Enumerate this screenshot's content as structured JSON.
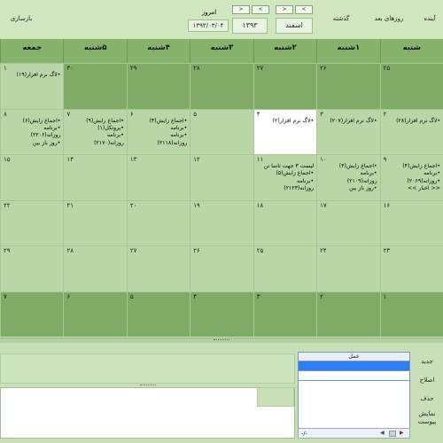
{
  "toolbar": {
    "future": "آینده",
    "next_days": "روزهای بعد",
    "past": "گذشته",
    "refresh": "بازسازی",
    "month": "اسفند",
    "year": "۱۳۹۳",
    "today_label": "امروز",
    "today_date": "۱۳۹۳/۰۳/۰۴",
    "nav_prev": "<",
    "nav_next": ">"
  },
  "weekdays": [
    "شنبه",
    "۱شنبه",
    "۲شنبه",
    "۳شنبه",
    "۴شنبه",
    "۵شنبه",
    "جمعه"
  ],
  "rows": [
    [
      {
        "n": "۲۵",
        "shade": "dark",
        "events": []
      },
      {
        "n": "۲۶",
        "shade": "dark",
        "events": []
      },
      {
        "n": "۲۷",
        "shade": "dark",
        "events": []
      },
      {
        "n": "۲۸",
        "shade": "dark",
        "events": []
      },
      {
        "n": "۲۹",
        "shade": "dark",
        "events": []
      },
      {
        "n": "۳۰",
        "shade": "dark",
        "events": []
      },
      {
        "n": "۱",
        "shade": "light",
        "events": [
          "•لاگ نرم افزار(۱۹)"
        ]
      }
    ],
    [
      {
        "n": "۲",
        "shade": "light",
        "events": [
          "•لاگ نرم افزار(۲۸)"
        ]
      },
      {
        "n": "۳",
        "shade": "light",
        "events": [
          "•لاگ نرم افزار(۲۰۷)"
        ]
      },
      {
        "n": "۴",
        "shade": "sel",
        "events": [
          "•لاگ نرم افزار(۲)"
        ]
      },
      {
        "n": "۵",
        "shade": "light",
        "events": []
      },
      {
        "n": "۶",
        "shade": "light",
        "events": [
          "•اجماع زایش(۳)",
          "•برنامه",
          "•برنامه",
          "روزانه(۲۱۱۸)"
        ]
      },
      {
        "n": "۷",
        "shade": "light",
        "events": [
          "•اجماع زایش(۹)",
          "•پروتکل(۱)",
          "•برنامه",
          "روزانه(۲۱۷۰)"
        ]
      },
      {
        "n": "۸",
        "shade": "light",
        "events": [
          "•اجماع زایش(۶)",
          "•برنامه",
          "روزانه(۲۲۰۶)",
          "•روز باز بین"
        ]
      }
    ],
    [
      {
        "n": "۹",
        "shade": "light",
        "events": [
          "•اجماع زایش(۴)",
          "•برنامه",
          "•روزانه(۲۰۶۹)",
          "<< اخبار >>"
        ]
      },
      {
        "n": "۱۰",
        "shade": "light",
        "events": [
          "•اجماع زایش(۴)",
          "•برنامه",
          "روزانه(۲۱۰۹)",
          "•روز باز بین"
        ]
      },
      {
        "n": "۱۱",
        "shade": "light",
        "events": [
          "لیست ۳ جهت تاسا تن",
          "•اجماع زایش(۵)",
          "•برنامه",
          "روزانه(۲۱۲۳)"
        ]
      },
      {
        "n": "۱۲",
        "shade": "light",
        "events": []
      },
      {
        "n": "۱۳",
        "shade": "light",
        "events": []
      },
      {
        "n": "۱۴",
        "shade": "light",
        "events": []
      },
      {
        "n": "۱۵",
        "shade": "light",
        "events": []
      }
    ],
    [
      {
        "n": "۱۶",
        "shade": "light",
        "events": []
      },
      {
        "n": "۱۷",
        "shade": "light",
        "events": []
      },
      {
        "n": "۱۸",
        "shade": "light",
        "events": []
      },
      {
        "n": "۱۹",
        "shade": "light",
        "events": []
      },
      {
        "n": "۲۰",
        "shade": "light",
        "events": []
      },
      {
        "n": "۲۱",
        "shade": "light",
        "events": []
      },
      {
        "n": "۲۲",
        "shade": "light",
        "events": []
      }
    ],
    [
      {
        "n": "۲۳",
        "shade": "light",
        "events": []
      },
      {
        "n": "۲۴",
        "shade": "light",
        "events": []
      },
      {
        "n": "۲۵",
        "shade": "light",
        "events": []
      },
      {
        "n": "۲۶",
        "shade": "light",
        "events": []
      },
      {
        "n": "۲۷",
        "shade": "light",
        "events": []
      },
      {
        "n": "۲۸",
        "shade": "light",
        "events": []
      },
      {
        "n": "۲۹",
        "shade": "light",
        "events": []
      }
    ],
    [
      {
        "n": "۱",
        "shade": "dark",
        "events": []
      },
      {
        "n": "۲",
        "shade": "dark",
        "events": []
      },
      {
        "n": "۳",
        "shade": "dark",
        "events": []
      },
      {
        "n": "۴",
        "shade": "dark",
        "events": []
      },
      {
        "n": "۵",
        "shade": "dark",
        "events": []
      },
      {
        "n": "۶",
        "shade": "dark",
        "events": []
      },
      {
        "n": "۷",
        "shade": "dark",
        "events": []
      }
    ]
  ],
  "panel": {
    "new": "جدید",
    "edit": "اصلاح",
    "delete": "حذف",
    "show_attach_1": "نمایش",
    "show_attach_2": "پیوست",
    "grid_header": "عمل",
    "scroll_value": "-/-"
  },
  "colors": {
    "accent": "#86b36c",
    "selected_row": "#2f7df5"
  }
}
